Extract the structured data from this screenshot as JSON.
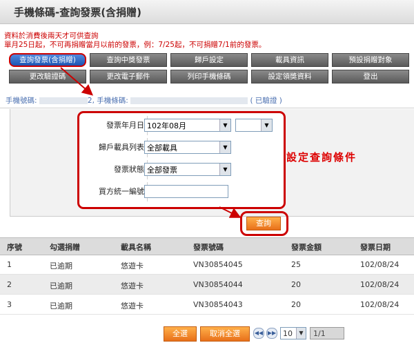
{
  "header": {
    "title": "手機條碼-查詢發票(含捐贈)"
  },
  "notices": [
    "資料於消費後兩天才可供查詢",
    "單月25日起，不可再捐贈當月以前的發票，例：7/25起，不可捐贈7/1前的發票。"
  ],
  "nav": {
    "items": [
      "查詢發票(含捐贈)",
      "查詢中獎發票",
      "歸戶設定",
      "載具資訊",
      "預設捐贈對象",
      "更改驗證碼",
      "更改電子郵件",
      "列印手機條碼",
      "設定領獎資料",
      "登出"
    ]
  },
  "account": {
    "label": "手機號碼:",
    "phone_tail": "2,",
    "barcode_label": "手機條碼:",
    "status": "( 已驗證 )"
  },
  "form": {
    "invoice_month_label": "發票年月日",
    "invoice_month_value": "102年08月",
    "invoice_day_value": "",
    "carrier_label": "歸戶載具列表",
    "carrier_value": "全部載具",
    "status_label": "發票狀態",
    "status_value": "全部發票",
    "buyer_id_label": "買方統一編號",
    "buyer_id_value": ""
  },
  "annotation": "設定查詢條件",
  "search_button": "查詢",
  "table": {
    "columns": [
      "序號",
      "勾選捐贈",
      "載具名稱",
      "發票號碼",
      "發票金額",
      "發票日期"
    ],
    "rows": [
      [
        "1",
        "已逾期",
        "悠遊卡",
        "VN30854045",
        "25",
        "102/08/24"
      ],
      [
        "2",
        "已逾期",
        "悠遊卡",
        "VN30854044",
        "20",
        "102/08/24"
      ],
      [
        "3",
        "已逾期",
        "悠遊卡",
        "VN30854043",
        "20",
        "102/08/24"
      ]
    ]
  },
  "pager": {
    "select_all": "全選",
    "deselect_all": "取消全選",
    "page_size": "10",
    "page_info": "1/1",
    "prev_icon": "double-left-arrow-icon",
    "next_icon": "double-right-arrow-icon"
  },
  "colors": {
    "highlight": "#cc0000",
    "active_nav": "#1d55b3",
    "nav": "#6e6e6e",
    "orange_button": "#e8701a",
    "link_blue": "#4a6fb0"
  }
}
